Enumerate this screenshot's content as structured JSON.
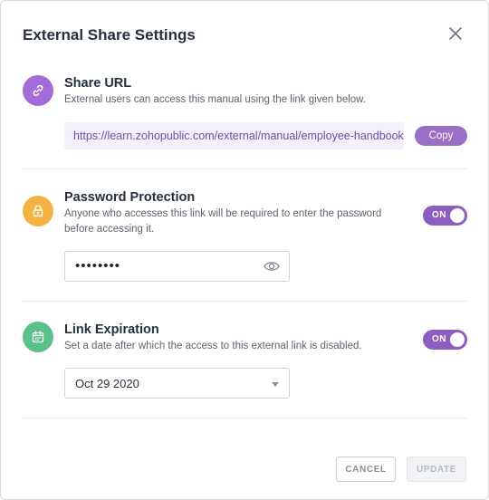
{
  "dialog": {
    "title": "External Share Settings",
    "close_icon": "close-icon"
  },
  "share_url": {
    "title": "Share URL",
    "description": "External users can access this manual using the link given below.",
    "url": "https://learn.zohopublic.com/external/manual/employee-handbook",
    "copy_label": "Copy",
    "icon": "link-icon",
    "icon_color": "#a56bd9"
  },
  "password_protection": {
    "title": "Password Protection",
    "description": "Anyone who accesses this link will be required to enter the password before accessing it.",
    "toggle_label": "ON",
    "password_masked": "••••••••",
    "icon": "lock-icon",
    "icon_color": "#f3b342",
    "visibility_icon": "eye-icon"
  },
  "link_expiration": {
    "title": "Link Expiration",
    "description": "Set a date after which the access to this external link is disabled.",
    "toggle_label": "ON",
    "date_value": "Oct 29 2020",
    "icon": "calendar-icon",
    "icon_color": "#5cc08a"
  },
  "footer": {
    "cancel_label": "CANCEL",
    "update_label": "UPDATE"
  },
  "colors": {
    "accent": "#8c5ec0",
    "url_background": "#f5f1fb"
  }
}
